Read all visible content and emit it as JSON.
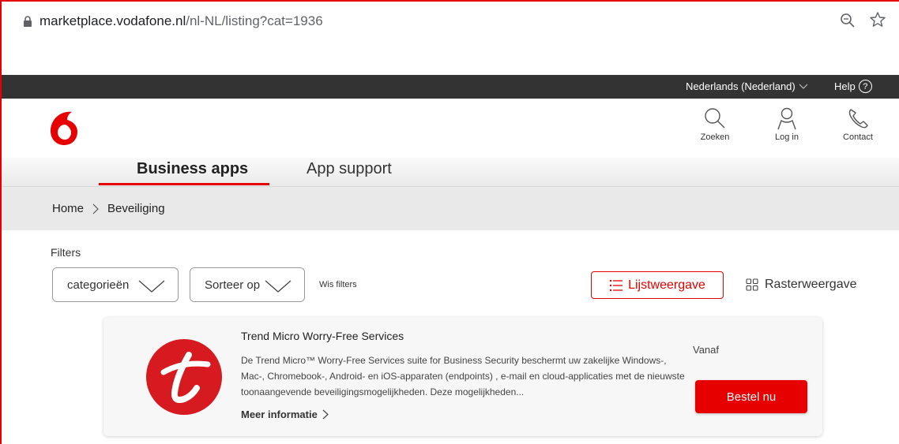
{
  "browser": {
    "url_host": "marketplace.vodafone.nl",
    "url_path": "/nl-NL/listing?cat=1936"
  },
  "topbar": {
    "language": "Nederlands (Nederland)",
    "help": "Help",
    "help_icon_glyph": "?"
  },
  "header": {
    "search_label": "Zoeken",
    "login_label": "Log in",
    "contact_label": "Contact",
    "brand_color": "#e60000"
  },
  "nav": {
    "tabs": [
      {
        "label": "Business apps",
        "active": true
      },
      {
        "label": "App support",
        "active": false
      }
    ]
  },
  "breadcrumb": {
    "items": [
      "Home",
      "Beveiliging"
    ]
  },
  "filters": {
    "label": "Filters",
    "category_dropdown": "categorieën",
    "sort_dropdown": "Sorteer op",
    "clear": "Wis filters",
    "list_view": "Lijstweergave",
    "grid_view": "Rasterweergave"
  },
  "products": [
    {
      "title": "Trend Micro Worry-Free Services",
      "description": "De Trend Micro™ Worry-Free Services suite for Business Security beschermt uw zakelijke Windows-, Mac-, Chromebook-, Android- en iOS-apparaten (endpoints) , e-mail en cloud-applicaties met de nieuwste toonaangevende beveiligingsmogelijkheden. Deze mogelijkheden...",
      "more_info": "Meer informatie",
      "price_prefix": "Vanaf",
      "order_button": "Bestel nu"
    }
  ]
}
